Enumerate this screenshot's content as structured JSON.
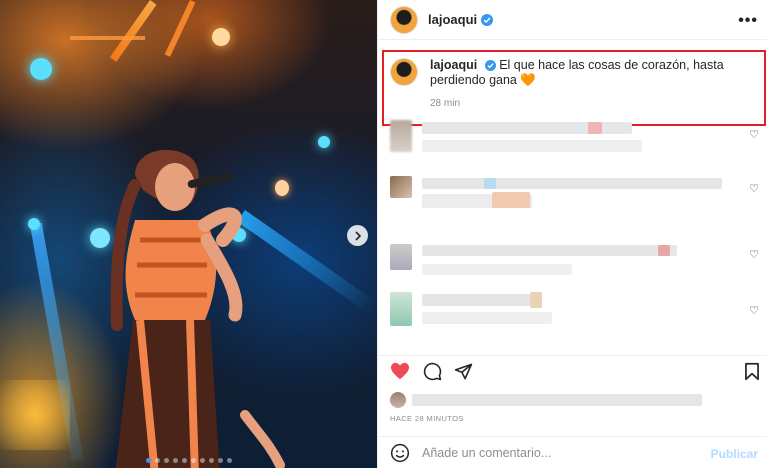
{
  "post": {
    "username": "lajoaqui",
    "caption_text": "El que hace las cosas de corazón, hasta perdiendo gana",
    "caption_emoji": "🧡",
    "time_short": "28 min",
    "time_long": "HACE 28 MINUTOS",
    "carousel_count": 10,
    "carousel_active": 1
  },
  "comment_box": {
    "placeholder": "Añade un comentario...",
    "publish_label": "Publicar"
  },
  "icons": {
    "more": "more-options-icon",
    "verified": "verified-badge-icon",
    "like": "heart-filled-icon",
    "comment": "comment-icon",
    "share": "share-icon",
    "save": "bookmark-icon",
    "emoji": "emoji-icon"
  },
  "colors": {
    "like_red": "#ed4956",
    "verified_blue": "#3897f0",
    "highlight_border": "#e21e26",
    "publish_disabled": "#b3dbff"
  }
}
